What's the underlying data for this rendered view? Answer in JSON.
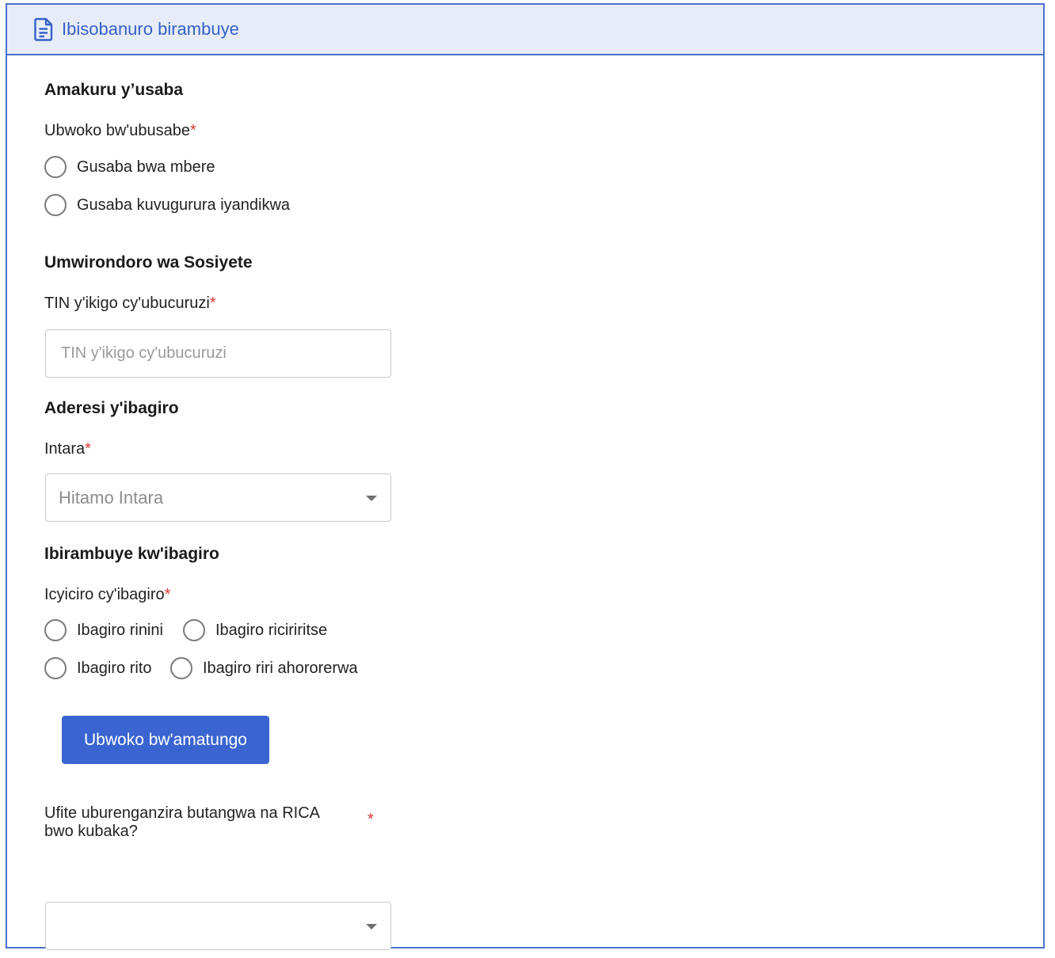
{
  "panel": {
    "title": "Ibisobanuro birambuye",
    "icon": "document-icon",
    "accent_color": "#3660c7",
    "border_color": "#4a72c9",
    "header_bg": "#e7edf8"
  },
  "application_info": {
    "section_title": "Amakuru y’usaba",
    "request_type": {
      "label": "Ubwoko bw'ubusabe",
      "required_mark": "*",
      "options": [
        "Gusaba bwa mbere",
        "Gusaba kuvugurura iyandikwa"
      ]
    }
  },
  "company_profile": {
    "section_title": "Umwirondoro wa Sosiyete",
    "tin": {
      "label": "TIN y'ikigo cy'ubucuruzi",
      "required_mark": "*",
      "placeholder": "TIN y'ikigo cy'ubucuruzi",
      "value": ""
    }
  },
  "workshop_address": {
    "section_title": "Aderesi y'ibagiro",
    "province": {
      "label": "Intara",
      "required_mark": "*",
      "placeholder": "Hitamo Intara"
    }
  },
  "workshop_details": {
    "section_title": "Ibirambuye kw'ibagiro",
    "category": {
      "label": "Icyiciro cy'ibagiro",
      "required_mark": "*",
      "options": [
        "Ibagiro rinini",
        "Ibagiro riciriritse",
        "Ibagiro rito",
        "Ibagiro riri ahororerwa"
      ]
    },
    "facilities_button": "Ubwoko bw'amatungo",
    "button_color": "#3a64d0"
  },
  "rica_permit": {
    "label_line1": "Ufite uburenganzira butangwa na RICA",
    "label_line2": "bwo kubaka?",
    "required_mark": "*",
    "selected": ""
  },
  "colors": {
    "required": "#d8393a"
  }
}
